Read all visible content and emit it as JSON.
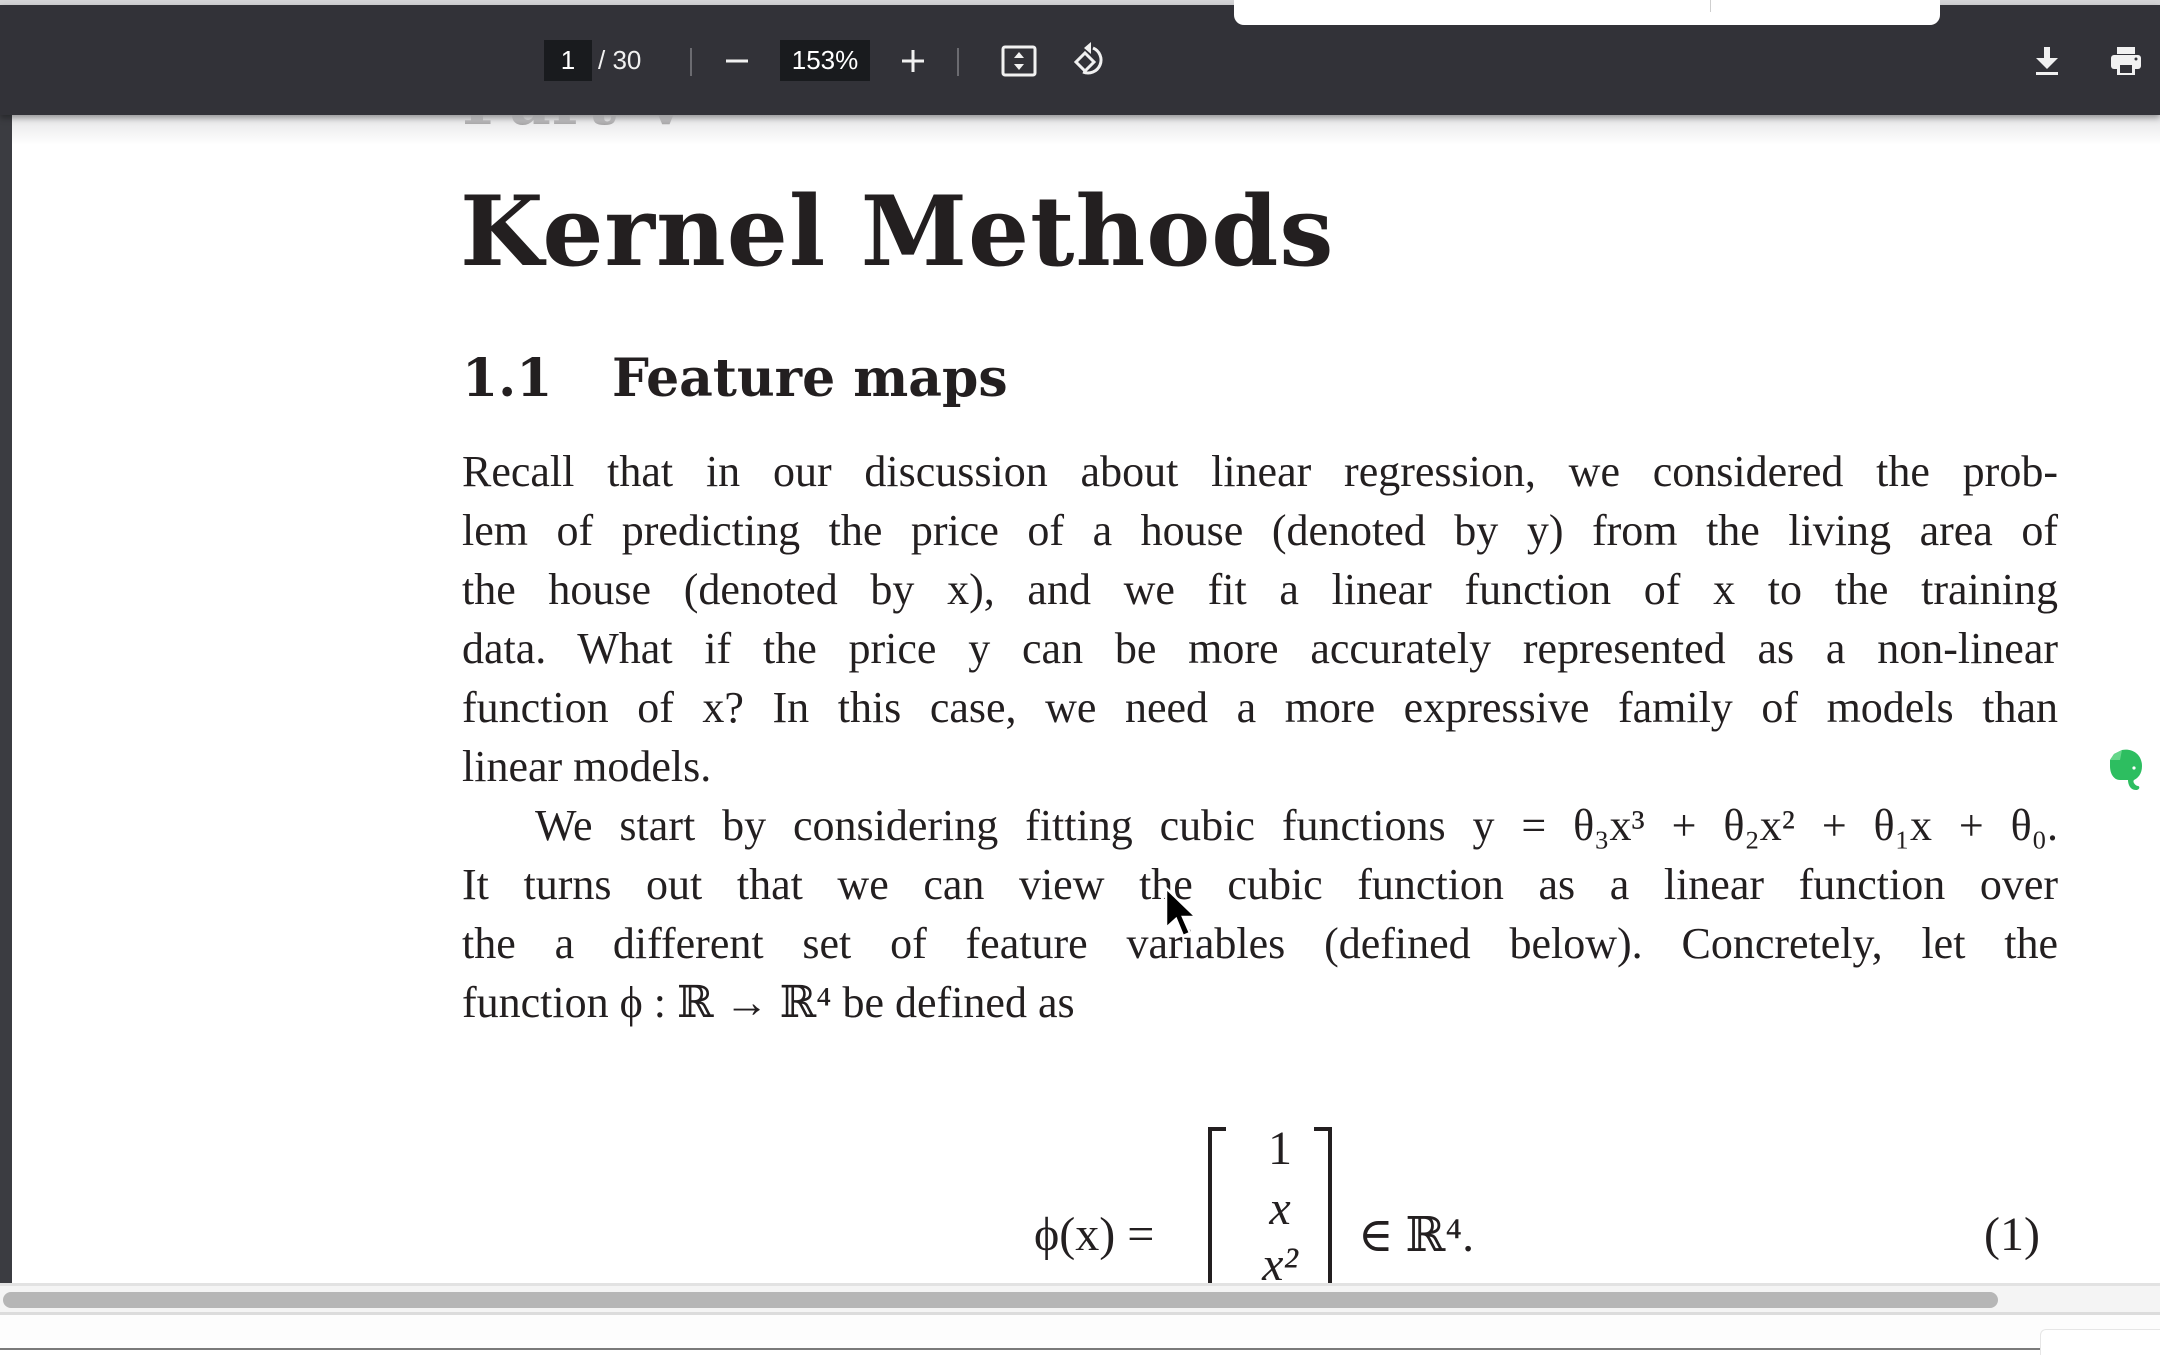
{
  "toolbar": {
    "page_current": "1",
    "page_total": "/ 30",
    "zoom_level": "153%",
    "zoom_out_icon": "minus-icon",
    "zoom_in_icon": "plus-icon",
    "fit_page_icon": "fit-to-page-icon",
    "rotate_icon": "rotate-counterclockwise-icon",
    "download_icon": "download-icon",
    "print_icon": "print-icon"
  },
  "document": {
    "part_heading": "Part V",
    "title": "Kernel Methods",
    "section_number": "1.1",
    "section_title": "Feature maps",
    "paragraph1": [
      "Recall that in our discussion about linear regression, we considered the prob-",
      "lem of predicting the price of a house (denoted by y) from the living area of",
      "the house (denoted by x), and we fit a linear function of x to the training",
      "data. What if the price y can be more accurately represented as a non-linear",
      "function of x? In this case, we need a more expressive family of models than",
      "linear models."
    ],
    "paragraph2": [
      "We start by considering fitting cubic functions y = θ₃x³ + θ₂x² + θ₁x + θ₀.",
      "It turns out that we can view the cubic function as a linear function over",
      "the a different set of feature variables (defined below). Concretely, let the",
      "function ϕ : ℝ → ℝ⁴ be defined as"
    ],
    "equation": {
      "lhs": "ϕ(x) =",
      "matrix_rows": [
        "1",
        "x",
        "x²"
      ],
      "rhs": "∈ ℝ⁴.",
      "number": "(1)"
    }
  },
  "overlay_icons": {
    "evernote": "evernote-icon",
    "cursor": "mouse-pointer-icon"
  },
  "colors": {
    "toolbar_bg": "#323238",
    "text": "#231f20",
    "evernote_green": "#2dbe60"
  }
}
